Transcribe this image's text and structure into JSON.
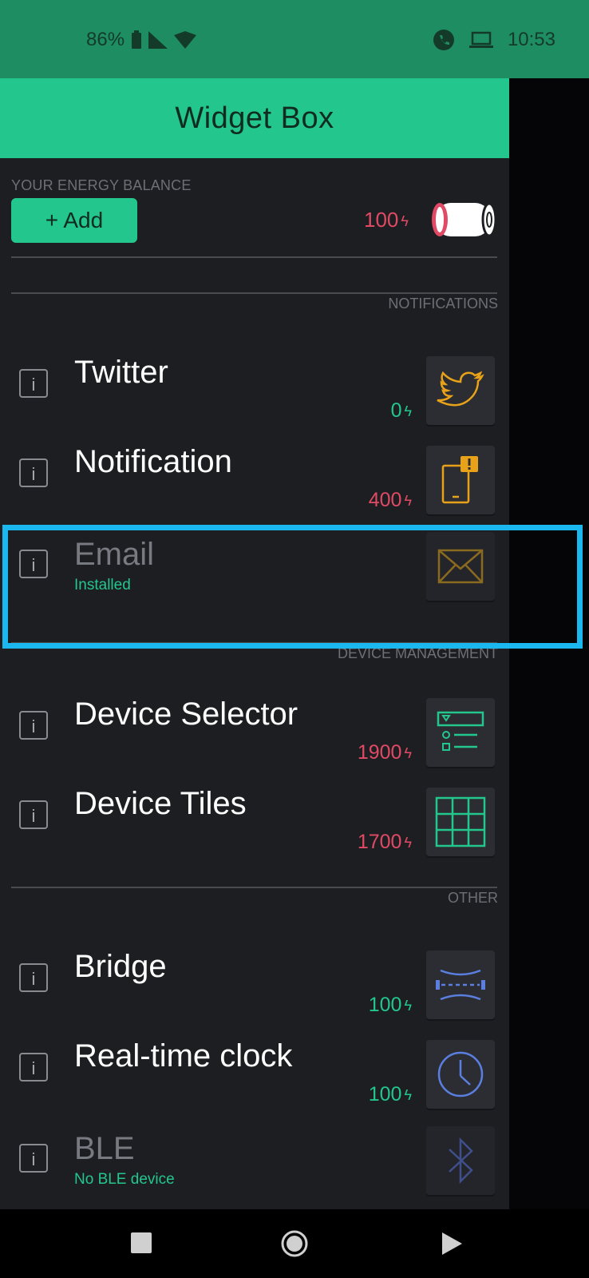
{
  "status_bar": {
    "battery": "86%",
    "time": "10:53"
  },
  "header": {
    "title": "Widget Box"
  },
  "energy": {
    "label": "YOUR ENERGY BALANCE",
    "add_label": "+ Add",
    "balance": "100",
    "bolt": "ϟ"
  },
  "sections": {
    "notifications": "NOTIFICATIONS",
    "device_management": "DEVICE MANAGEMENT",
    "other": "OTHER"
  },
  "info_glyph": "i",
  "widgets": [
    {
      "title": "Twitter",
      "cost": "0",
      "icon": "twitter-icon"
    },
    {
      "title": "Notification",
      "cost": "400",
      "icon": "notification-icon"
    },
    {
      "title": "Email",
      "subtitle": "Installed",
      "icon": "email-icon"
    },
    {
      "title": "Device Selector",
      "cost": "1900",
      "icon": "device-selector-icon"
    },
    {
      "title": "Device Tiles",
      "cost": "1700",
      "icon": "device-tiles-icon"
    },
    {
      "title": "Bridge",
      "cost": "100",
      "icon": "bridge-icon"
    },
    {
      "title": "Real-time clock",
      "cost": "100",
      "icon": "clock-icon"
    },
    {
      "title": "BLE",
      "subtitle": "No BLE device",
      "icon": "bluetooth-icon"
    }
  ],
  "colors": {
    "accent": "#23c68c",
    "cost_red": "#e04a64",
    "highlight": "#1bb8ef"
  }
}
